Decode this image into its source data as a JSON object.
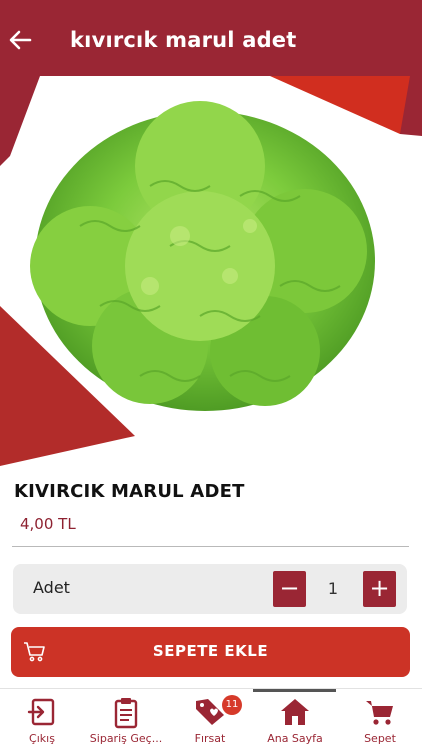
{
  "header": {
    "title": "kıvırcık marul adet"
  },
  "product": {
    "name": "KIVIRCIK MARUL ADET",
    "price": "4,00 TL",
    "image_alt": "lettuce"
  },
  "quantity": {
    "label": "Adet",
    "value": "1",
    "minus": "−",
    "plus": "+"
  },
  "cart_button": {
    "label": "SEPETE EKLE"
  },
  "nav": {
    "items": [
      {
        "label": "Çıkış",
        "icon": "logout-icon"
      },
      {
        "label": "Sipariş Geç...",
        "icon": "clipboard-icon"
      },
      {
        "label": "Fırsat",
        "icon": "tag-heart-icon",
        "badge": "11"
      },
      {
        "label": "Ana Sayfa",
        "icon": "home-icon",
        "active": true
      },
      {
        "label": "Sepet",
        "icon": "cart-icon"
      }
    ]
  },
  "colors": {
    "primary": "#9a2634",
    "accent": "#cc3326",
    "lettuce": "#7ccb3c"
  }
}
